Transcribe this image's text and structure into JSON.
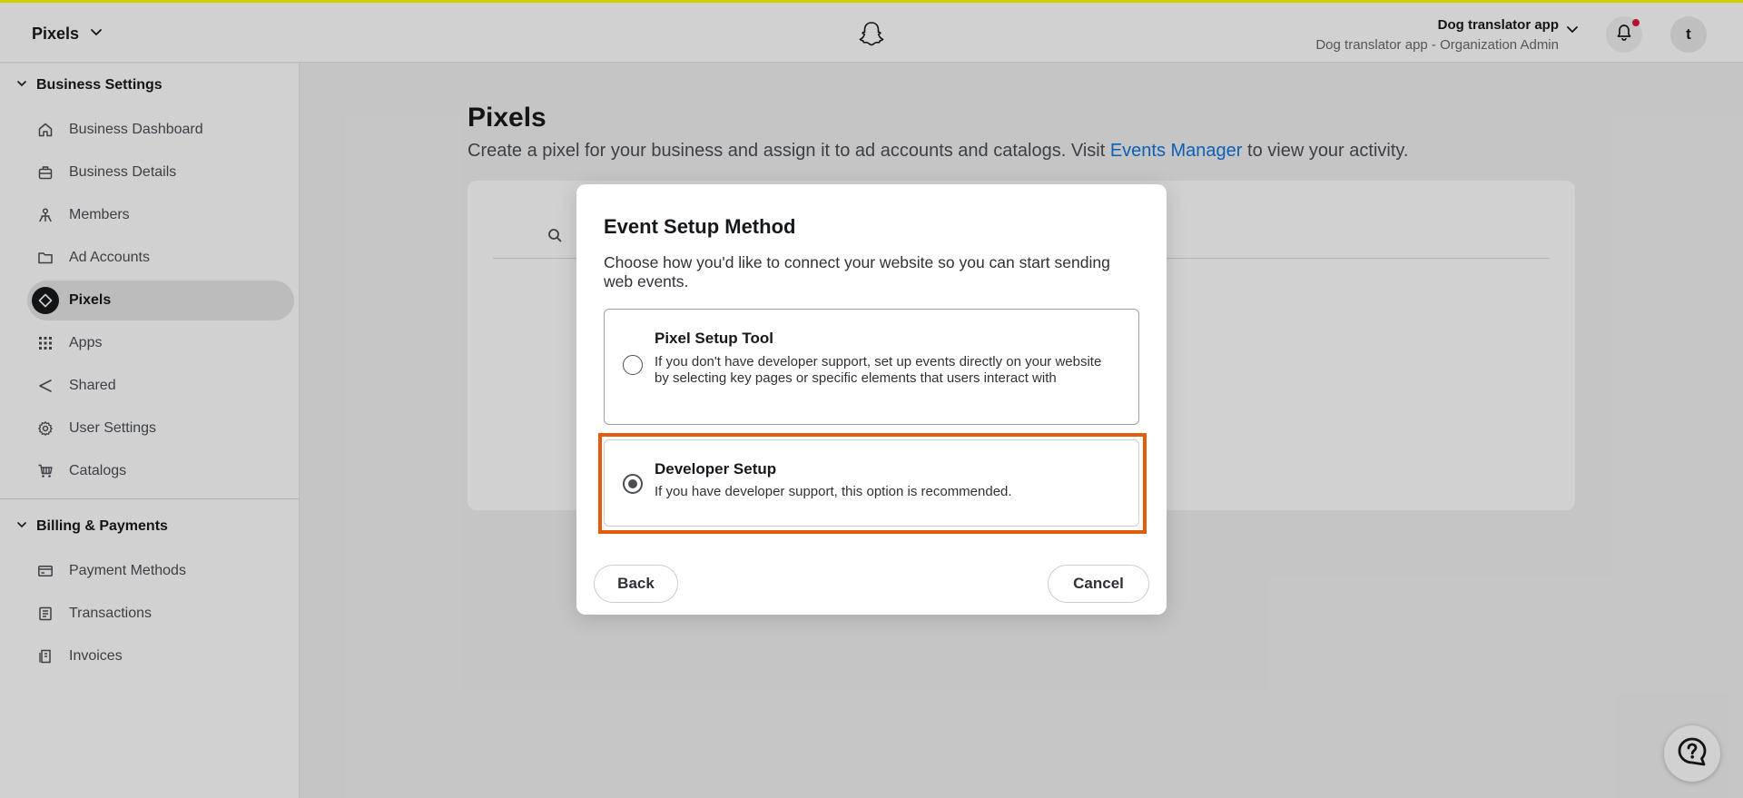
{
  "topbar": {
    "app_switcher_label": "Pixels",
    "org_name": "Dog translator app",
    "org_role": "Dog translator app - Organization Admin",
    "avatar_initial": "t"
  },
  "sidebar": {
    "sections": [
      {
        "label": "Business Settings",
        "items": [
          {
            "label": "Business Dashboard",
            "icon": "home-icon"
          },
          {
            "label": "Business Details",
            "icon": "briefcase-icon"
          },
          {
            "label": "Members",
            "icon": "members-icon"
          },
          {
            "label": "Ad Accounts",
            "icon": "folder-icon"
          },
          {
            "label": "Pixels",
            "icon": "pixel-diamond-icon",
            "active": true
          },
          {
            "label": "Apps",
            "icon": "apps-grid-icon"
          },
          {
            "label": "Shared",
            "icon": "share-icon"
          },
          {
            "label": "User Settings",
            "icon": "gear-icon"
          },
          {
            "label": "Catalogs",
            "icon": "cart-icon"
          }
        ]
      },
      {
        "label": "Billing & Payments",
        "items": [
          {
            "label": "Payment Methods",
            "icon": "credit-card-icon"
          },
          {
            "label": "Transactions",
            "icon": "receipt-icon"
          },
          {
            "label": "Invoices",
            "icon": "invoice-icon"
          }
        ]
      }
    ]
  },
  "main": {
    "title": "Pixels",
    "subtitle_before": "Create a pixel for your business and assign it to ad accounts and catalogs. Visit ",
    "subtitle_link": "Events Manager",
    "subtitle_after": " to view your activity.",
    "search_placeholder": "Search"
  },
  "modal": {
    "title": "Event Setup Method",
    "description": "Choose how you'd like to connect your website so you can start sending web events.",
    "options": [
      {
        "title": "Pixel Setup Tool",
        "text": "If you don't have developer support, set up events directly on your website by selecting key pages or specific elements that users interact with",
        "selected": false
      },
      {
        "title": "Developer Setup",
        "text": "If you have developer support, this option is recommended.",
        "selected": true
      }
    ],
    "back_label": "Back",
    "cancel_label": "Cancel"
  },
  "colors": {
    "accent_link": "#0f75e0",
    "highlight": "#e35b0c",
    "notification_dot": "#e1143c",
    "snap_yellow": "#fffc00"
  }
}
